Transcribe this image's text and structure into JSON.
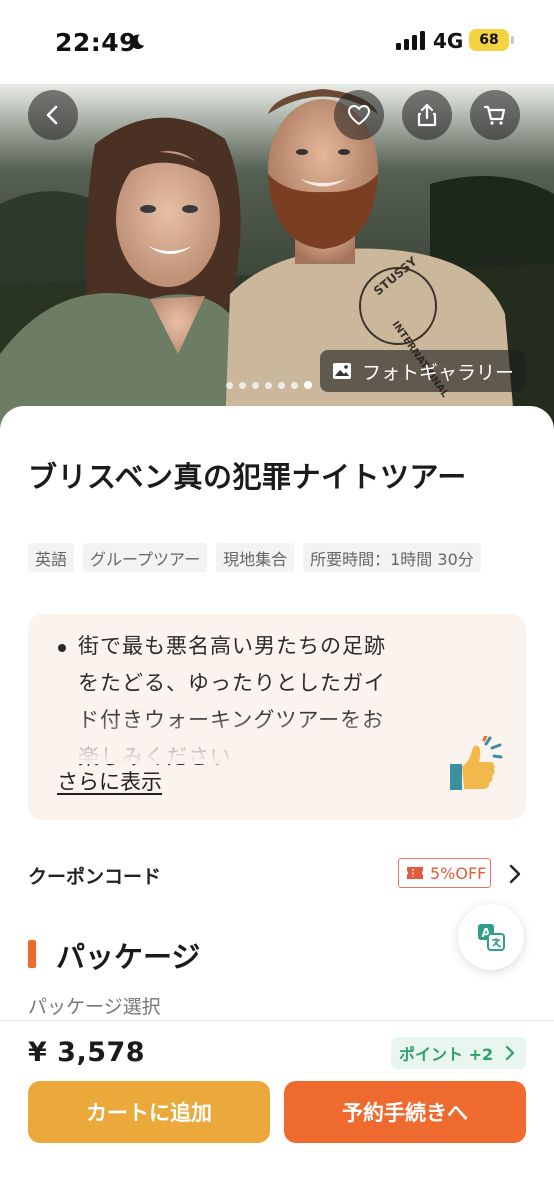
{
  "status_bar": {
    "time": "22:49",
    "network": "4G",
    "battery": "68"
  },
  "hero": {
    "gallery_label": "フォトギャラリー",
    "photo_count": 7,
    "active_index": 6,
    "icons": [
      "back-arrow-icon",
      "heart-icon",
      "share-icon",
      "cart-icon",
      "image-icon"
    ]
  },
  "product": {
    "title": "ブリスベン真の犯罪ナイトツアー",
    "tags": [
      "英語",
      "グループツアー",
      "現地集合",
      "所要時間：1時間 30分"
    ],
    "description_lines": [
      "街で最も悪名高い男たちの足跡",
      "をたどる、ゆったりとしたガイ",
      "ド付きウォーキングツアーをお",
      "楽しみください"
    ],
    "show_more": "さらに表示"
  },
  "coupon": {
    "label": "クーポンコード",
    "badge": "5%OFF"
  },
  "package": {
    "title": "パッケージ",
    "subtitle": "パッケージ選択"
  },
  "bottom_bar": {
    "price": "¥ 3,578",
    "points": "ポイント +2",
    "add_to_cart": "カートに追加",
    "book": "予約手続きへ"
  },
  "colors": {
    "accent_orange": "#ee6a2f",
    "cart_yellow": "#eaa93a",
    "points_green": "#2f9e6a",
    "coupon_red": "#e25c3e"
  }
}
